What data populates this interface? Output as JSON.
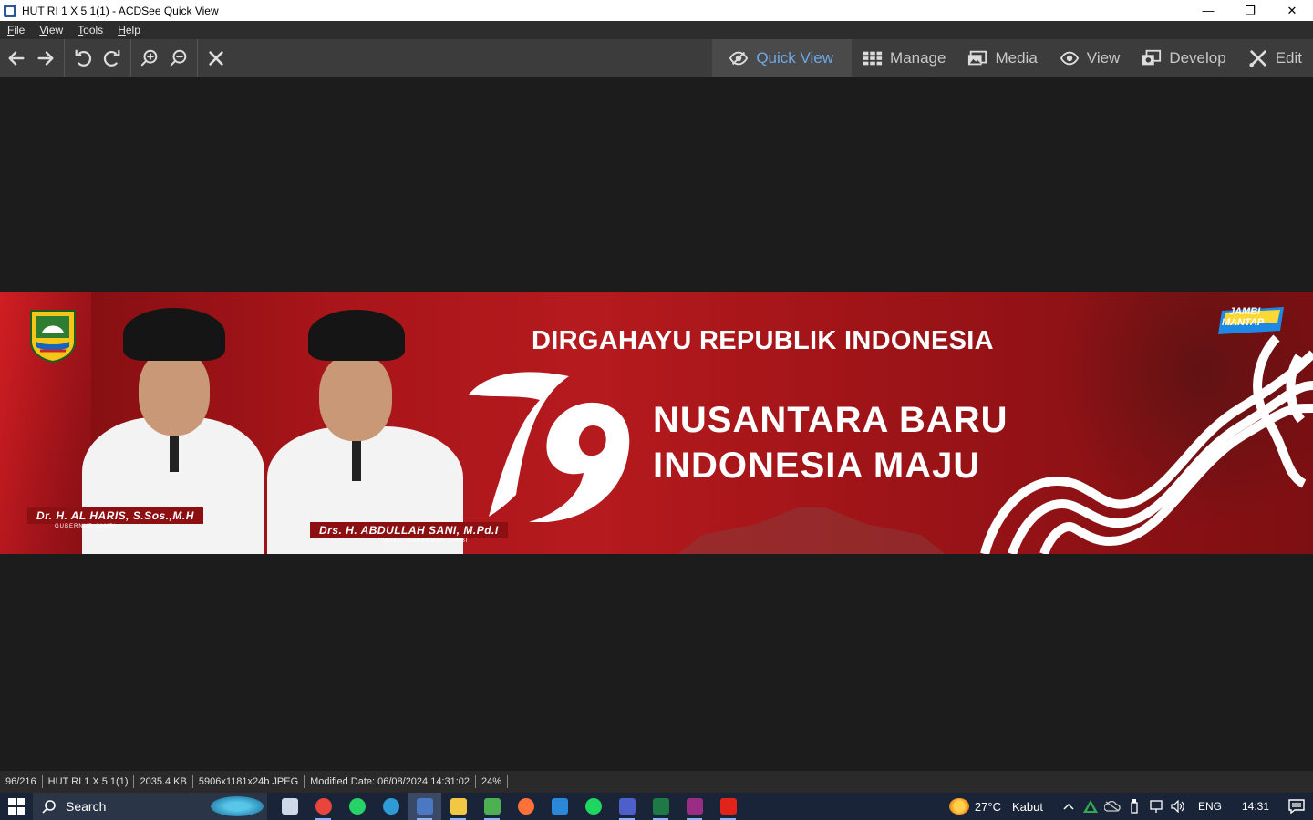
{
  "window": {
    "title": "HUT RI 1 X 5 1(1) - ACDSee Quick View",
    "minimize": "—",
    "restore": "❐",
    "close": "✕"
  },
  "menu": {
    "items": [
      {
        "label": "File",
        "accel": "F",
        "rest": "ile"
      },
      {
        "label": "View",
        "accel": "V",
        "rest": "iew"
      },
      {
        "label": "Tools",
        "accel": "T",
        "rest": "ools"
      },
      {
        "label": "Help",
        "accel": "H",
        "rest": "elp"
      }
    ]
  },
  "toolbar": {
    "icons": [
      "back-arrow-icon",
      "forward-arrow-icon",
      "rotate-left-icon",
      "rotate-right-icon",
      "zoom-in-icon",
      "zoom-out-icon",
      "close-icon"
    ]
  },
  "modes": [
    {
      "label": "Quick View",
      "icon": "eye-slash-icon",
      "active": true
    },
    {
      "label": "Manage",
      "icon": "grid-icon",
      "active": false
    },
    {
      "label": "Media",
      "icon": "photos-icon",
      "active": false
    },
    {
      "label": "View",
      "icon": "eye-icon",
      "active": false
    },
    {
      "label": "Develop",
      "icon": "develop-icon",
      "active": false
    },
    {
      "label": "Edit",
      "icon": "edit-tools-icon",
      "active": false
    }
  ],
  "banner": {
    "headline": "DIRGAHAYU REPUBLIK INDONESIA",
    "number": "79",
    "slogan_line1": "NUSANTARA BARU",
    "slogan_line2": "INDONESIA MAJU",
    "person1_name": "Dr. H. AL HARIS, S.Sos.,M.H",
    "person1_title": "GUBERNUR JAMBI",
    "person2_name": "Drs. H. ABDULLAH SANI, M.Pd.I",
    "person2_title": "WAKIL GUBERNUR JAMBI",
    "logo_right_line1": "JAMBI",
    "logo_right_line2": "MANTAP"
  },
  "status": {
    "position": "96/216",
    "filename": "HUT RI 1 X 5 1(1)",
    "size": "2035.4 KB",
    "dimensions": "5906x1181x24b JPEG",
    "modified": "Modified Date: 06/08/2024 14:31:02",
    "zoom": "24%"
  },
  "taskbar": {
    "search_label": "Search",
    "apps": [
      {
        "name": "task-view-icon",
        "color": "#cfd8e6"
      },
      {
        "name": "chrome-icon",
        "color": "#e8453c"
      },
      {
        "name": "whatsapp-icon",
        "color": "#25d366"
      },
      {
        "name": "edge-icon",
        "color": "#2f9bd6"
      },
      {
        "name": "acdsee-icon",
        "color": "#4a78c2"
      },
      {
        "name": "file-explorer-icon",
        "color": "#f2c744"
      },
      {
        "name": "corel-icon",
        "color": "#4caf50"
      },
      {
        "name": "firefox-icon",
        "color": "#ff7139"
      },
      {
        "name": "mail-icon",
        "color": "#2b88d8"
      },
      {
        "name": "spotify-icon",
        "color": "#1ed760"
      },
      {
        "name": "app-icon",
        "color": "#4d5fc9"
      },
      {
        "name": "excel-icon",
        "color": "#1d7a45"
      },
      {
        "name": "winrar-icon",
        "color": "#9b2c84"
      },
      {
        "name": "acrobat-icon",
        "color": "#e2231a"
      }
    ],
    "weather_temp": "27°C",
    "weather_desc": "Kabut",
    "language": "ENG",
    "time": "14:31"
  }
}
